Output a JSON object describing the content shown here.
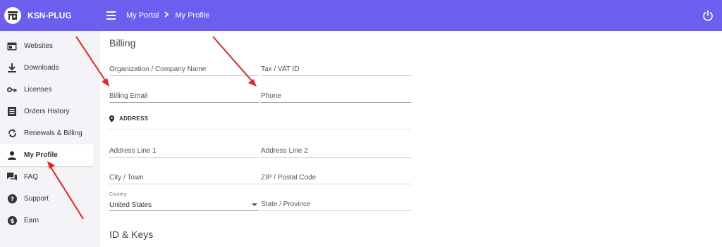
{
  "app": {
    "name": "KSN-PLUG"
  },
  "breadcrumb": {
    "root": "My Portal",
    "current": "My Profile"
  },
  "colors": {
    "topbar": "#6c5ff0",
    "sidebar_bg": "#f4f4f8",
    "arrow": "#e8231f"
  },
  "sidebar": {
    "items": [
      {
        "label": "Websites",
        "icon": "browser-window-icon",
        "active": false
      },
      {
        "label": "Downloads",
        "icon": "download-icon",
        "active": false
      },
      {
        "label": "Licenses",
        "icon": "key-icon",
        "active": false
      },
      {
        "label": "Orders History",
        "icon": "list-document-icon",
        "active": false
      },
      {
        "label": "Renewals & Billing",
        "icon": "refresh-icon",
        "active": false
      },
      {
        "label": "My Profile",
        "icon": "person-icon",
        "active": true
      },
      {
        "label": "FAQ",
        "icon": "chat-bubbles-icon",
        "active": false
      },
      {
        "label": "Support",
        "icon": "help-circle-icon",
        "active": false
      },
      {
        "label": "Earn",
        "icon": "dollar-circle-icon",
        "active": false
      }
    ]
  },
  "billing": {
    "title": "Billing",
    "org_placeholder": "Organization / Company Name",
    "tax_placeholder": "Tax / VAT ID",
    "email_placeholder": "Billing Email",
    "phone_placeholder": "Phone"
  },
  "address": {
    "heading": "ADDRESS",
    "line1_placeholder": "Address Line 1",
    "line2_placeholder": "Address Line 2",
    "city_placeholder": "City / Town",
    "zip_placeholder": "ZIP / Postal Code",
    "country_label": "Country",
    "country_value": "United States",
    "state_placeholder": "State / Province"
  },
  "keys": {
    "title": "ID & Keys"
  }
}
